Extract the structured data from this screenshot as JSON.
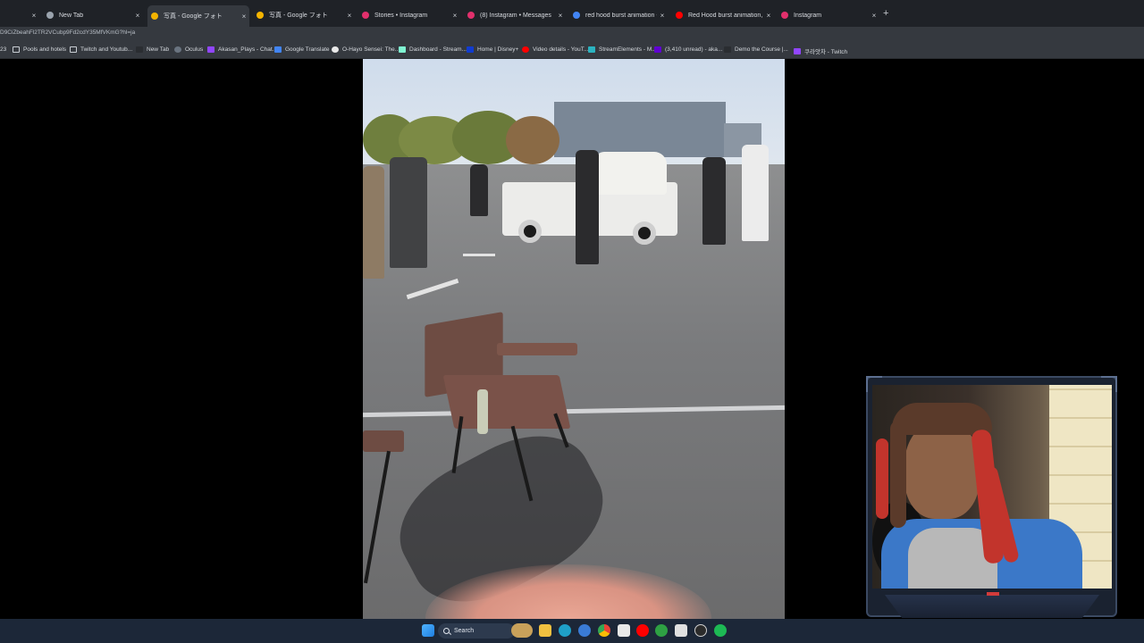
{
  "browser": {
    "tabs": [
      {
        "title": "",
        "favicon_color": "#3b3f45",
        "active": false
      },
      {
        "title": "New Tab",
        "favicon_color": "#9aa3ad",
        "active": false
      },
      {
        "title": "写真 - Google フォト",
        "favicon_color": "#f4b400",
        "active": true
      },
      {
        "title": "写真 - Google フォト",
        "favicon_color": "#f4b400",
        "active": false
      },
      {
        "title": "Stories • Instagram",
        "favicon_color": "#e1306c",
        "active": false
      },
      {
        "title": "(8) Instagram • Messages",
        "favicon_color": "#e1306c",
        "active": false
      },
      {
        "title": "red hood burst animation - Go",
        "favicon_color": "#4285f4",
        "active": false
      },
      {
        "title": "Red Hood burst animation, Nik",
        "favicon_color": "#ff0000",
        "active": false
      },
      {
        "title": "Instagram",
        "favicon_color": "#e1306c",
        "active": false
      }
    ],
    "new_tab_symbol": "+",
    "close_symbol": "×",
    "address": "D9CiZbeahFl2TR2VCubp9Fd2cdY35MfVKmG?hl=ja",
    "bookmarks": [
      {
        "label": "23",
        "icon": "none"
      },
      {
        "label": "Pools and hotels",
        "icon": "folder"
      },
      {
        "label": "Twitch and Youtub...",
        "icon": "folder"
      },
      {
        "label": "New Tab",
        "icon": "page"
      },
      {
        "label": "Oculus",
        "icon": "oculus"
      },
      {
        "label": "Akasan_Plays - Chat...",
        "icon": "twitch"
      },
      {
        "label": "Google Translate",
        "icon": "translate"
      },
      {
        "label": "O-Hayo Sensei: The...",
        "icon": "page"
      },
      {
        "label": "Dashboard - Stream...",
        "icon": "streamlabs"
      },
      {
        "label": "Home | Disney+",
        "icon": "disney"
      },
      {
        "label": "Video details - YouT...",
        "icon": "youtube"
      },
      {
        "label": "StreamElements - M...",
        "icon": "streamelements"
      },
      {
        "label": "(3,410 unread) - aka...",
        "icon": "yahoo"
      },
      {
        "label": "Demo the Course |...",
        "icon": "page"
      },
      {
        "label": "쿠라앗차 - Twitch",
        "icon": "twitch"
      }
    ]
  },
  "taskbar": {
    "search_label": "Search",
    "icons": [
      "windows-start",
      "search",
      "widget",
      "file-explorer",
      "edge",
      "edge-alt",
      "chrome",
      "store",
      "youtube",
      "xbox",
      "capcut",
      "obs",
      "spotify"
    ]
  },
  "colors": {
    "tabstrip": "#1f2227",
    "toolbar": "#35393f",
    "taskbar": "#1c2738",
    "webcam_frame": "#3b4a63"
  }
}
